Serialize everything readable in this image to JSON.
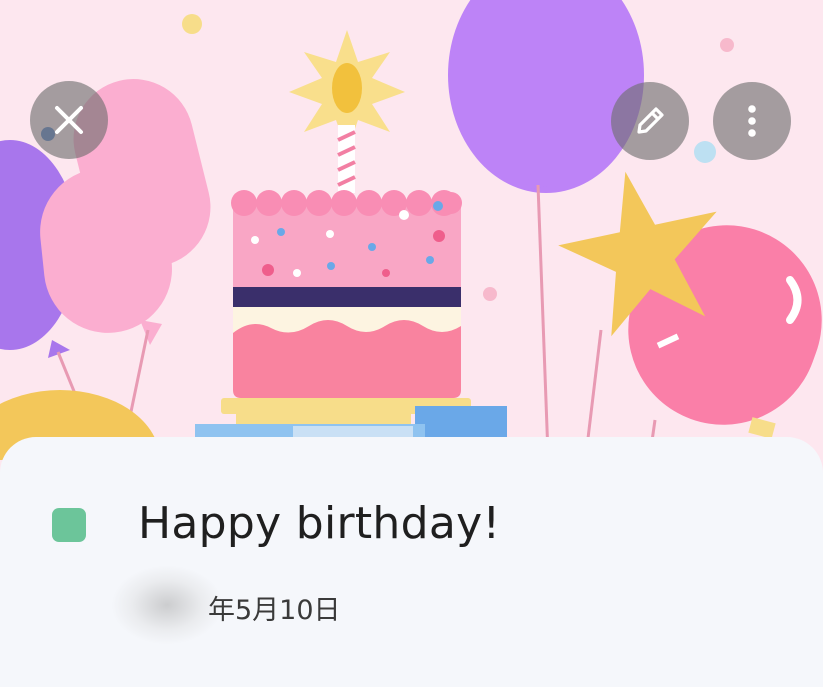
{
  "event": {
    "title": "Happy birthday!",
    "date": "年5月10日",
    "color": "#6cc59a"
  },
  "toolbar": {
    "close_icon": "close-icon",
    "edit_icon": "pencil-icon",
    "more_icon": "more-vertical-icon"
  },
  "colors": {
    "header_background": "#fde7ef",
    "sheet_background": "#f5f7fb",
    "button_overlay": "#6e6e6e"
  }
}
